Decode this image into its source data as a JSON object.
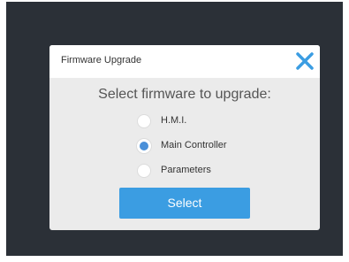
{
  "dialog": {
    "title": "Firmware Upgrade",
    "close_icon": "close-icon",
    "accent_color": "#3b9de2"
  },
  "prompt": "Select firmware to upgrade:",
  "options": [
    {
      "label": "H.M.I.",
      "checked": false
    },
    {
      "label": "Main Controller",
      "checked": true
    },
    {
      "label": "Parameters",
      "checked": false
    }
  ],
  "select_label": "Select"
}
